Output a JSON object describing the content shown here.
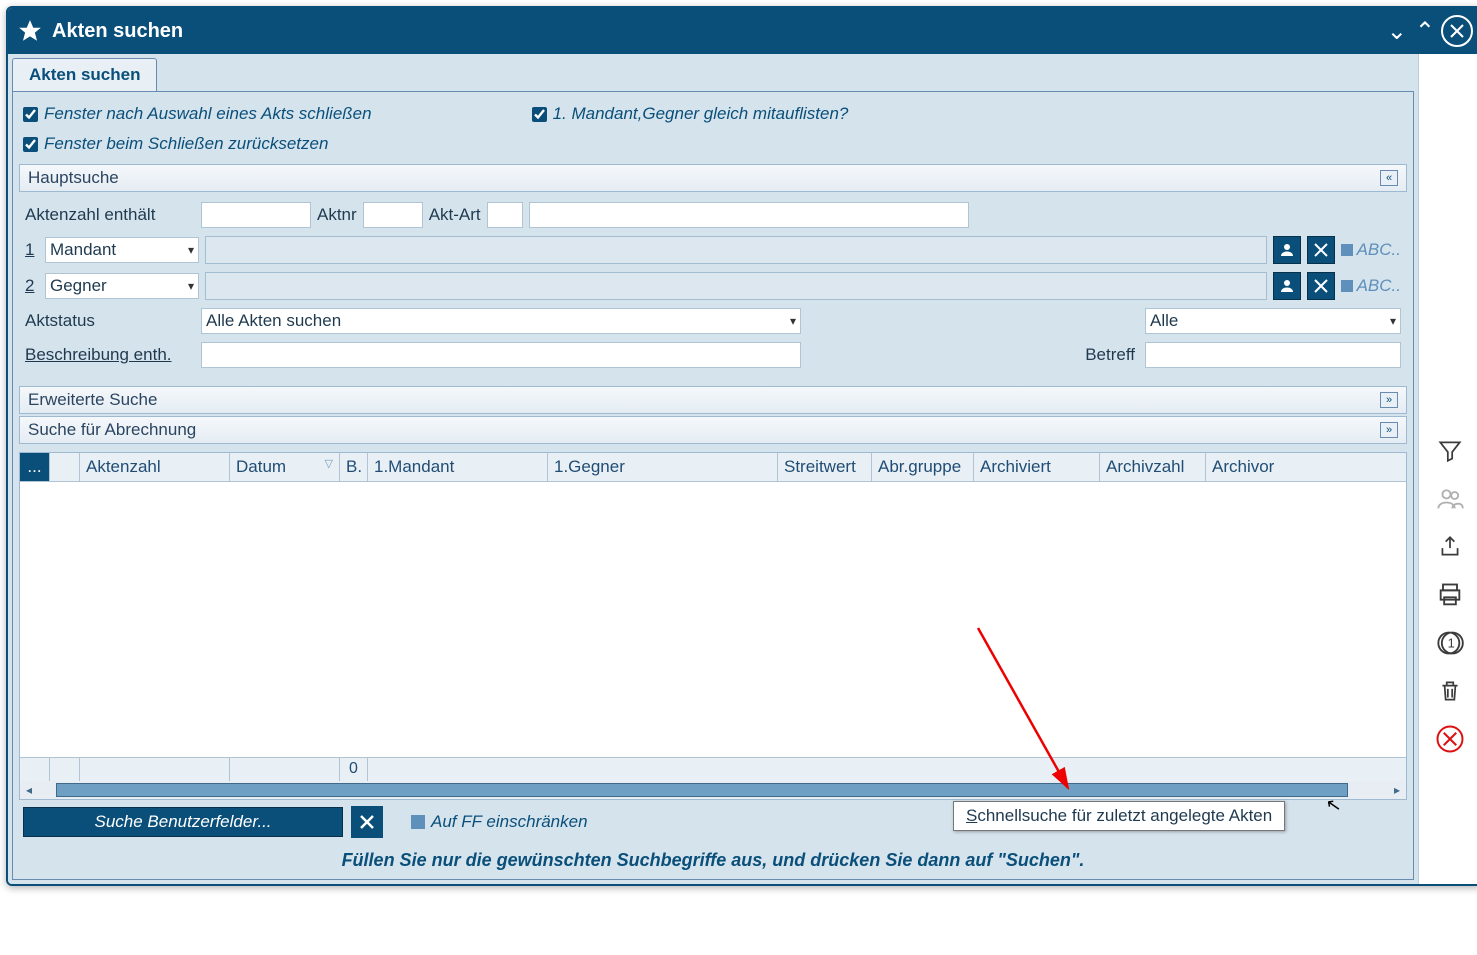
{
  "titlebar": {
    "title": "Akten suchen"
  },
  "tabs": {
    "active": "Akten suchen"
  },
  "options": {
    "close_after_select": "Fenster nach Auswahl eines Akts schließen",
    "list_parties": "1. Mandant,Gegner gleich mitauflisten?",
    "reset_on_close": "Fenster beim Schließen zurücksetzen"
  },
  "sections": {
    "main": "Hauptsuche",
    "extended": "Erweiterte Suche",
    "billing": "Suche für Abrechnung"
  },
  "form": {
    "aktenzahl_label": "Aktenzahl enthält",
    "aktnr_label": "Aktnr",
    "aktart_label": "Akt-Art",
    "row1_num": "1",
    "row1_role": "Mandant",
    "row2_num": "2",
    "row2_role": "Gegner",
    "abc": "ABC..",
    "aktstatus_label": "Aktstatus",
    "aktstatus_value": "Alle Akten suchen",
    "alle_value": "Alle",
    "beschreibung_label": "Beschreibung enth.",
    "betreff_label": "Betreff"
  },
  "grid": {
    "cols": {
      "menu": "...",
      "aktenzahl": "Aktenzahl",
      "datum": "Datum",
      "b": "B.",
      "mandant": "1.Mandant",
      "gegner": "1.Gegner",
      "streitwert": "Streitwert",
      "abrgruppe": "Abr.gruppe",
      "archiviert": "Archiviert",
      "archivzahl": "Archivzahl",
      "archivort": "Archivor"
    },
    "footer_count": "0"
  },
  "bottom": {
    "userfields": "Suche Benutzerfelder...",
    "ff_restrict": "Auf FF einschränken",
    "quicksearch_tooltip_pre": "S",
    "quicksearch_tooltip_rest": "chnellsuche für zuletzt angelegte Akten"
  },
  "hint": "Füllen Sie nur die gewünschten Suchbegriffe aus, und drücken Sie dann auf \"Suchen\"."
}
